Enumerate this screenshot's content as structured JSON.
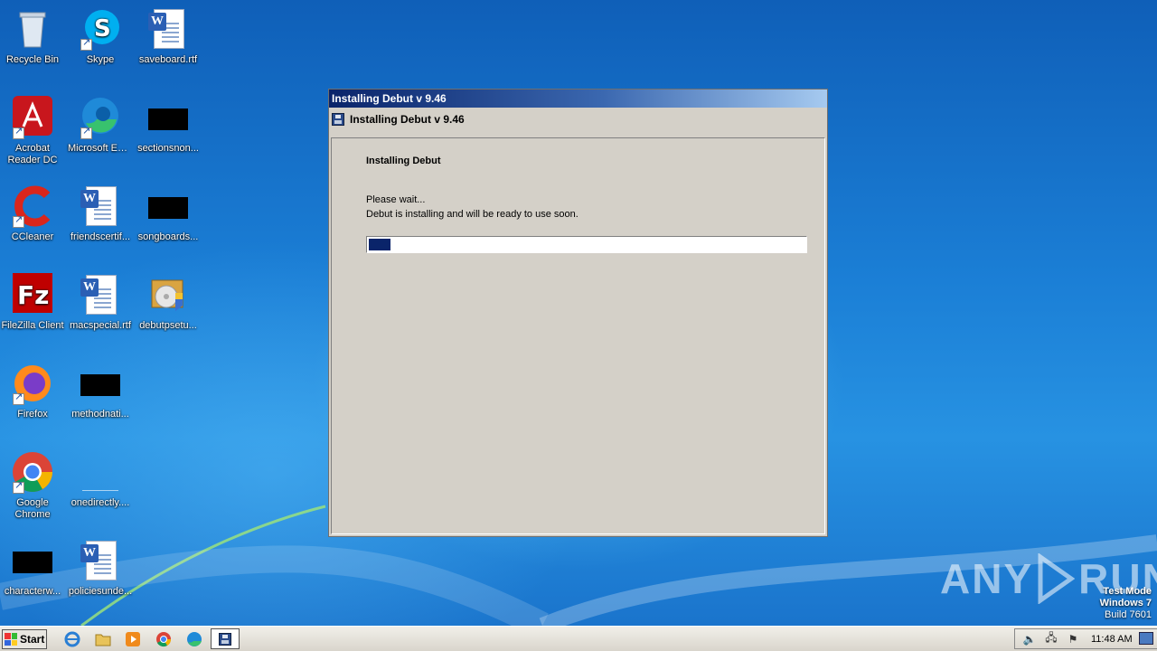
{
  "desktop": {
    "icons": [
      {
        "label": "Recycle Bin"
      },
      {
        "label": "Skype"
      },
      {
        "label": "saveboard.rtf"
      },
      {
        "label": "Acrobat Reader DC"
      },
      {
        "label": "Microsoft Edge"
      },
      {
        "label": "sectionsnon..."
      },
      {
        "label": "CCleaner"
      },
      {
        "label": "friendscertif..."
      },
      {
        "label": "songboards..."
      },
      {
        "label": "FileZilla Client"
      },
      {
        "label": "macspecial.rtf"
      },
      {
        "label": "debutpsetu..."
      },
      {
        "label": "Firefox"
      },
      {
        "label": "methodnati..."
      },
      {
        "label": "Google Chrome"
      },
      {
        "label": "onedirectly...."
      },
      {
        "label": "characterw..."
      },
      {
        "label": "policiesunde..."
      }
    ]
  },
  "window": {
    "title": "Installing Debut v 9.46",
    "header_title": "Installing Debut v 9.46",
    "section_title": "Installing Debut",
    "line1": "Please wait...",
    "line2": "Debut is installing and will be ready to use soon.",
    "progress_percent": 5
  },
  "watermark": {
    "brand_left": "ANY",
    "brand_right": "RUN"
  },
  "system_info": {
    "line1": "Test Mode",
    "line2": "Windows 7",
    "line3": "Build 7601"
  },
  "taskbar": {
    "start_label": "Start",
    "clock": "11:48 AM",
    "pinned": [
      "internet-explorer-icon",
      "folder-icon",
      "media-player-icon",
      "chrome-icon",
      "edge-icon",
      "debut-installer-icon"
    ]
  }
}
